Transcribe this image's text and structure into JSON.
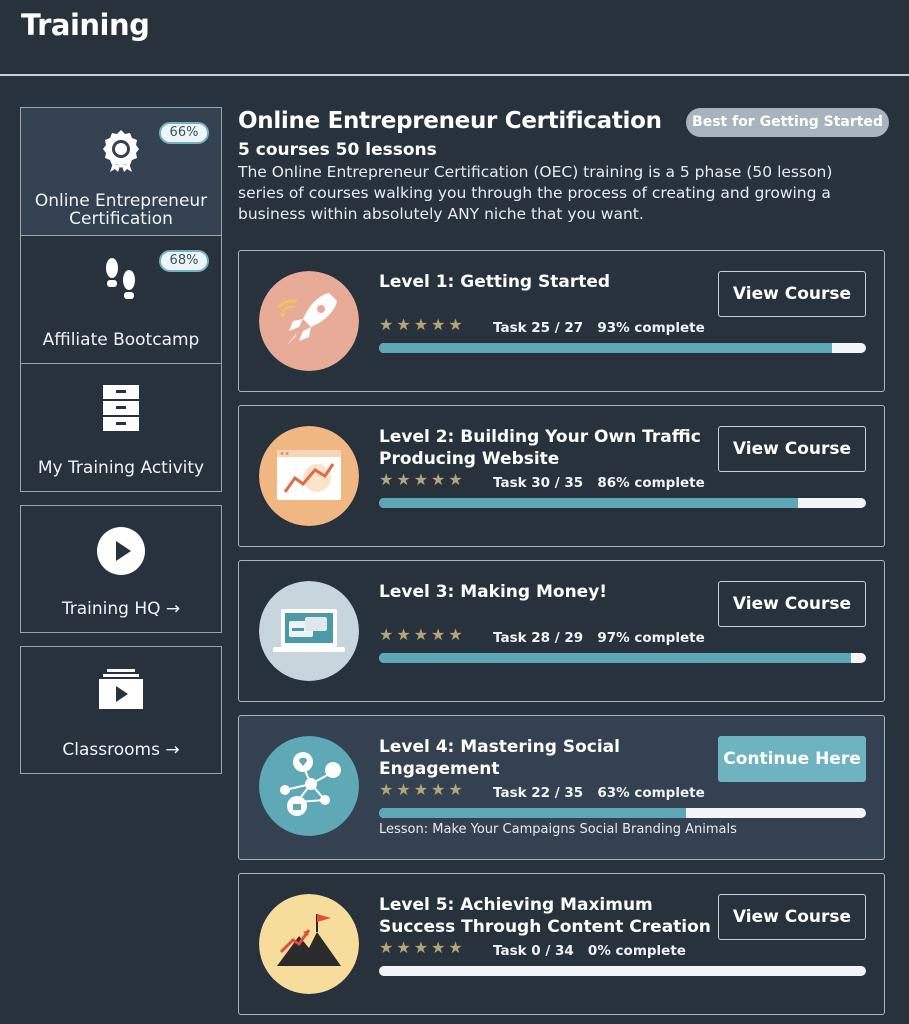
{
  "header": {
    "title": "Training"
  },
  "sidebar": {
    "items": [
      {
        "label": "Online Entrepreneur Certification",
        "percent": "66%",
        "icon": "award-ribbon-icon"
      },
      {
        "label": "Affiliate Bootcamp",
        "percent": "68%",
        "icon": "footprints-icon"
      },
      {
        "label": "My Training Activity",
        "icon": "filing-cabinet-icon"
      },
      {
        "label": "Training HQ →",
        "icon": "play-circle-icon"
      },
      {
        "label": "Classrooms →",
        "icon": "video-stack-icon"
      }
    ]
  },
  "course": {
    "title": "Online Entrepreneur Certification",
    "badge": "Best for Getting Started",
    "subtitle": "5 courses 50 lessons",
    "description": "The Online Entrepreneur Certification (OEC) training is a 5 phase (50 lesson) series of courses walking you through the process of creating and growing a business within absolutely ANY niche that you want."
  },
  "levels": [
    {
      "title": "Level 1: Getting Started",
      "stars": "★★★★★",
      "task": "Task 25 / 27",
      "complete": "93% complete",
      "progress": 0.93,
      "button": "View Course",
      "icon": "rocket-icon",
      "color": "#e8ab98"
    },
    {
      "title": "Level 2: Building Your Own Traffic Producing Website",
      "stars": "★★★★★",
      "task": "Task 30 / 35",
      "complete": "86% complete",
      "progress": 0.86,
      "button": "View Course",
      "icon": "website-chart-icon",
      "color": "#f0b783"
    },
    {
      "title": "Level 3: Making Money!",
      "stars": "★★★★★",
      "task": "Task 28 / 29",
      "complete": "97% complete",
      "progress": 0.97,
      "button": "View Course",
      "icon": "laptop-payment-icon",
      "color": "#c7d6dc"
    },
    {
      "title": "Level 4: Mastering Social Engagement",
      "stars": "★★★★★",
      "task": "Task 22 / 35",
      "complete": "63% complete",
      "progress": 0.63,
      "button": "Continue Here",
      "lesson": "Lesson: Make Your Campaigns Social Branding Animals",
      "icon": "social-network-icon",
      "color": "#5fa8b5"
    },
    {
      "title": "Level 5: Achieving Maximum Success Through Content Creation",
      "stars": "★★★★★",
      "task": "Task 0 / 34",
      "complete": "0% complete",
      "progress": 0.0,
      "button": "View Course",
      "icon": "mountain-flag-icon",
      "color": "#f7dd9c"
    }
  ]
}
